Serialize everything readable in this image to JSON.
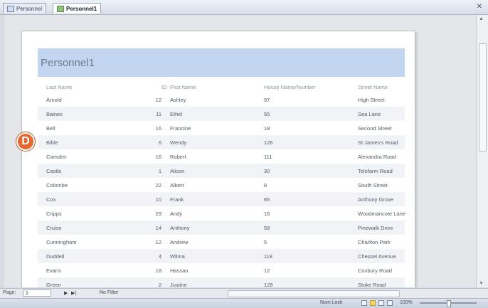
{
  "tabs": [
    {
      "label": "Personnel",
      "active": false
    },
    {
      "label": "Personnel1",
      "active": true
    }
  ],
  "report": {
    "title": "Personnel1",
    "columns": [
      "Last Name",
      "ID",
      "First Name",
      "House Name/Number",
      "Street Name"
    ],
    "rows": [
      [
        "Arnold",
        "12",
        "Ashley",
        "97",
        "High Street"
      ],
      [
        "Baines",
        "11",
        "Ethel",
        "55",
        "Sea Lane"
      ],
      [
        "Bell",
        "16",
        "Francine",
        "18",
        "Second Street"
      ],
      [
        "Bible",
        "6",
        "Wendy",
        "126",
        "St James's Road"
      ],
      [
        "Camden",
        "16",
        "Robert",
        "111",
        "Alexandra Road"
      ],
      [
        "Castle",
        "1",
        "Alison",
        "30",
        "Telefarm Road"
      ],
      [
        "Colombe",
        "22",
        "Albert",
        "8",
        "South Street"
      ],
      [
        "Cox",
        "10",
        "Frank",
        "85",
        "Anthony Grove"
      ],
      [
        "Cripps",
        "29",
        "Andy",
        "16",
        "Woodmancote Lane"
      ],
      [
        "Cruise",
        "14",
        "Anthony",
        "59",
        "Pinewalk Drive"
      ],
      [
        "Cunningham",
        "12",
        "Andrew",
        "5",
        "Charlton Park"
      ],
      [
        "Duddell",
        "4",
        "Wilma",
        "118",
        "Chessel Avenue"
      ],
      [
        "Evans",
        "18",
        "Hassan",
        "12",
        "Coxbury Road"
      ],
      [
        "Green",
        "2",
        "Justine",
        "128",
        "Stoke Road"
      ]
    ]
  },
  "callout": {
    "letter": "D",
    "color": "#e7672e"
  },
  "navbar": {
    "page_label": "Page:",
    "page_value": "1",
    "filter_label": "No Filter"
  },
  "statusbar": {
    "mode": "Num Lock",
    "zoom": "100%"
  }
}
